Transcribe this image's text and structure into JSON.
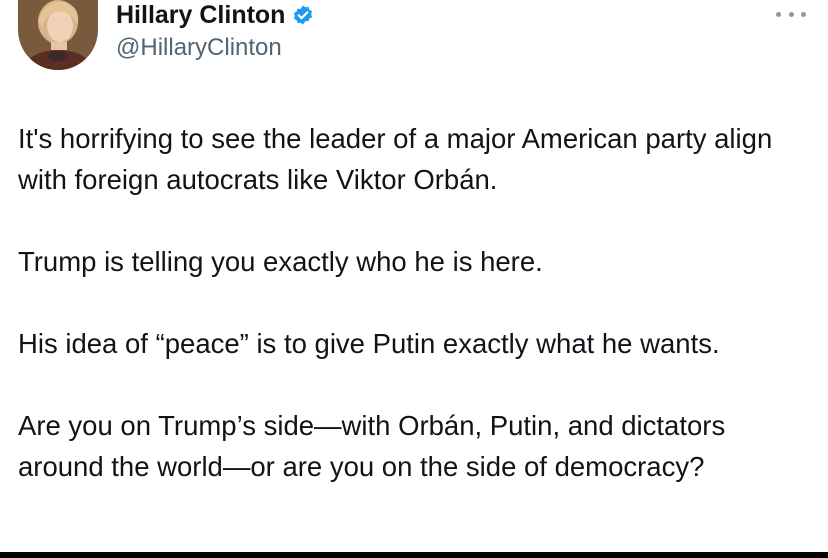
{
  "author": {
    "display_name": "Hillary Clinton",
    "handle": "@HillaryClinton",
    "verified": true,
    "verified_color": "#1d9bf0"
  },
  "icons": {
    "verified": "verified-badge-icon",
    "more": "more-options-icon",
    "avatar": "profile-photo"
  },
  "tweet": {
    "paragraphs": [
      "It's horrifying to see the leader of a major American party align with foreign autocrats like Viktor Orbán.",
      "Trump is telling you exactly who he is here.",
      "His idea of “peace” is to give Putin exactly what he wants.",
      "Are you on Trump’s side—with Orbán, Putin, and dictators around the world—or are you on the side of democracy?"
    ]
  },
  "colors": {
    "text": "#0f1419",
    "secondary_text": "#536471",
    "background": "#ffffff"
  }
}
